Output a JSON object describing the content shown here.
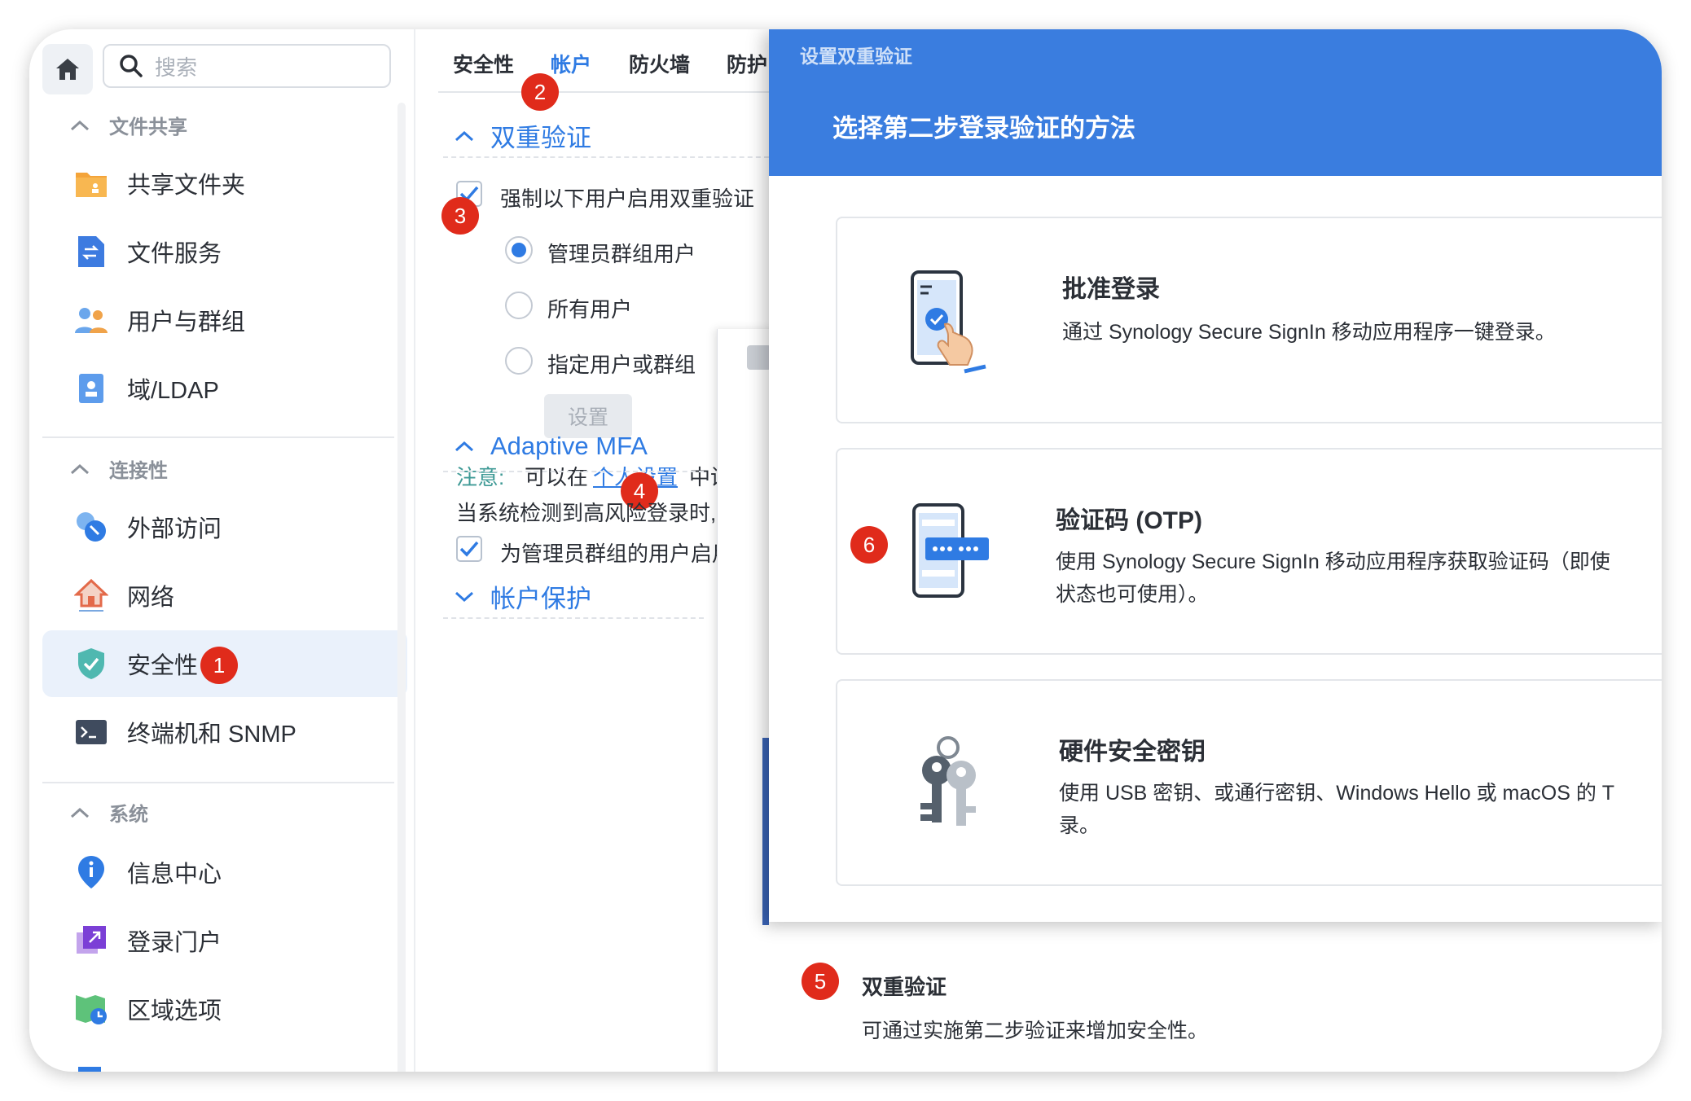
{
  "sidebar": {
    "search_placeholder": "搜索",
    "sections": [
      {
        "title": "文件共享",
        "items": [
          {
            "label": "共享文件夹",
            "icon": "shared-folder-icon"
          },
          {
            "label": "文件服务",
            "icon": "file-services-icon"
          },
          {
            "label": "用户与群组",
            "icon": "users-groups-icon"
          },
          {
            "label": "域/LDAP",
            "icon": "domain-ldap-icon"
          }
        ]
      },
      {
        "title": "连接性",
        "items": [
          {
            "label": "外部访问",
            "icon": "external-access-icon"
          },
          {
            "label": "网络",
            "icon": "network-icon"
          },
          {
            "label": "安全性",
            "icon": "security-shield-icon",
            "active": true
          },
          {
            "label": "终端机和 SNMP",
            "icon": "terminal-icon"
          }
        ]
      },
      {
        "title": "系统",
        "items": [
          {
            "label": "信息中心",
            "icon": "info-center-icon"
          },
          {
            "label": "登录门户",
            "icon": "login-portal-icon"
          },
          {
            "label": "区域选项",
            "icon": "regional-options-icon"
          }
        ]
      }
    ]
  },
  "tabs": [
    "安全性",
    "帐户",
    "防火墙",
    "防护"
  ],
  "active_tab": "帐户",
  "content": {
    "two_factor_title": "双重验证",
    "enforce_label": "强制以下用户启用双重验证",
    "radio_admin": "管理员群组用户",
    "radio_all": "所有用户",
    "radio_specific": "指定用户或群组",
    "settings_button": "设置",
    "note_label": "注意:",
    "note_text_before": "可以在",
    "note_link": "个人设置",
    "note_text_after": "中设",
    "adaptive_title": "Adaptive MFA",
    "adaptive_desc": "当系统检测到高风险登录时,",
    "adaptive_check": "为管理员群组的用户启用",
    "account_protect_title": "帐户保护"
  },
  "badges": [
    "1",
    "2",
    "3",
    "4",
    "5",
    "6"
  ],
  "modal": {
    "subtitle": "设置双重验证",
    "title": "选择第二步登录验证的方法",
    "options": [
      {
        "title": "批准登录",
        "desc": [
          "通过 Synology Secure SignIn 移动应用程序一键登录。"
        ],
        "icon": "phone-approve-icon"
      },
      {
        "title": "验证码 (OTP)",
        "desc": [
          "使用 Synology Secure SignIn 移动应用程序获取验证码（即使",
          "状态也可使用）。"
        ],
        "icon": "phone-otp-icon"
      },
      {
        "title": "硬件安全密钥",
        "desc": [
          "使用 USB 密钥、或通行密钥、Windows Hello 或 macOS 的 T",
          "录。"
        ],
        "icon": "security-keys-icon"
      }
    ]
  },
  "footer": {
    "title": "双重验证",
    "desc": "可通过实施第二步验证来增加安全性。"
  },
  "colors": {
    "accent": "#2f7be3",
    "modal_header": "#3a7ddf",
    "badge": "#e02b1b"
  }
}
